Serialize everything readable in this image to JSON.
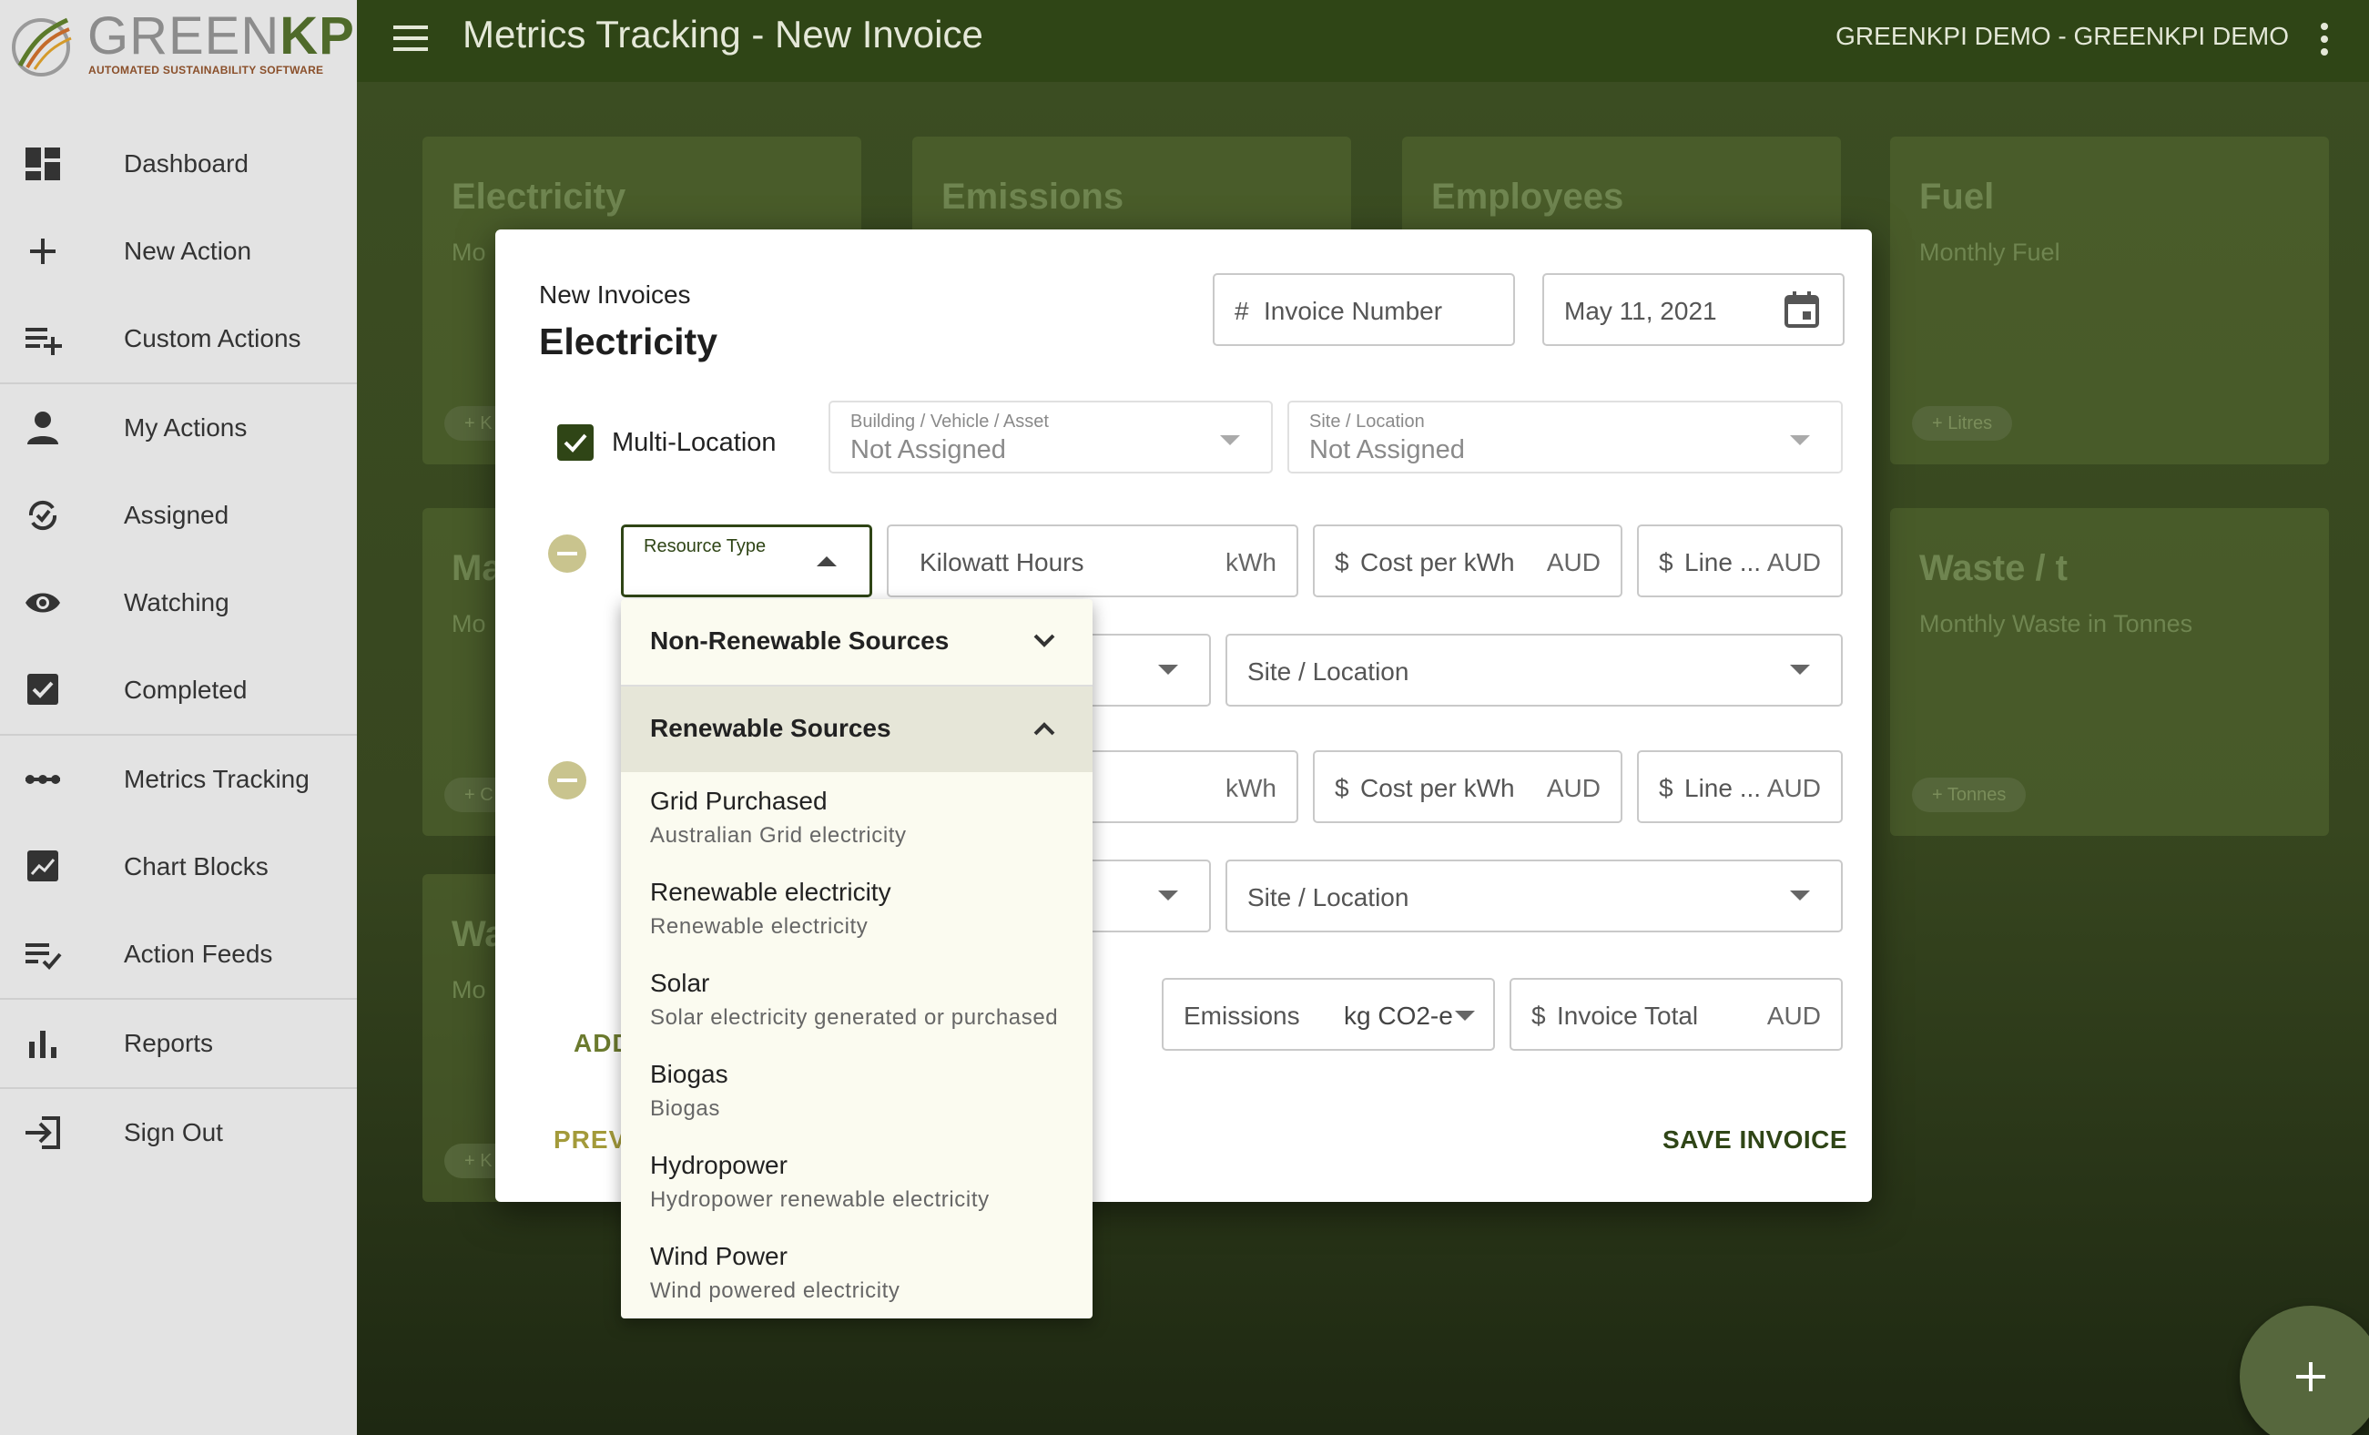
{
  "app": {
    "brand_main": "GREEN",
    "brand_accent": "KPI",
    "tagline": "AUTOMATED SUSTAINABILITY SOFTWARE",
    "page_title": "Metrics Tracking - New Invoice",
    "org": "GREENKPI DEMO - GREENKPI DEMO"
  },
  "sidebar": {
    "items": [
      {
        "label": "Dashboard",
        "icon": "dashboard-icon"
      },
      {
        "label": "New Action",
        "icon": "plus-icon"
      },
      {
        "label": "Custom Actions",
        "icon": "playlist-add-icon"
      },
      {
        "label": "My Actions",
        "icon": "person-icon"
      },
      {
        "label": "Assigned",
        "icon": "sync-check-icon"
      },
      {
        "label": "Watching",
        "icon": "eye-icon"
      },
      {
        "label": "Completed",
        "icon": "checkbox-icon"
      },
      {
        "label": "Metrics Tracking",
        "icon": "dots-line-icon"
      },
      {
        "label": "Chart Blocks",
        "icon": "chart-block-icon"
      },
      {
        "label": "Action Feeds",
        "icon": "list-check-icon"
      },
      {
        "label": "Reports",
        "icon": "bar-chart-icon"
      },
      {
        "label": "Sign Out",
        "icon": "sign-out-icon"
      }
    ]
  },
  "background_cards": [
    {
      "title": "Electricity",
      "subtitle": "Mo",
      "chip": "+ K"
    },
    {
      "title": "Emissions",
      "subtitle": "",
      "chip": ""
    },
    {
      "title": "Employees",
      "subtitle": "",
      "chip": ""
    },
    {
      "title": "Fuel",
      "subtitle": "Monthly Fuel",
      "chip": "+ Litres"
    },
    {
      "title": "Ma",
      "subtitle": "Mo",
      "chip": "+ C"
    },
    {
      "title": "Waste / t",
      "subtitle": "Monthly Waste in Tonnes",
      "chip": "+ Tonnes"
    },
    {
      "title": "Wa",
      "subtitle": "Mo",
      "chip": "+ K"
    }
  ],
  "dialog": {
    "subtitle": "New Invoices",
    "title": "Electricity",
    "invoice_number_placeholder": "Invoice Number",
    "invoice_number_prefix": "#",
    "date": "May 11, 2021",
    "multi_location_label": "Multi-Location",
    "multi_location_checked": true,
    "building_label": "Building / Vehicle / Asset",
    "building_value": "Not Assigned",
    "site_label": "Site / Location",
    "site_value": "Not Assigned",
    "lines": [
      {
        "resource_type_label": "Resource Type",
        "quantity_placeholder": "Kilowatt Hours",
        "quantity_unit": "kWh",
        "cost_prefix": "$",
        "cost_placeholder": "Cost per kWh",
        "cost_unit": "AUD",
        "line_prefix": "$",
        "line_placeholder": "Line ...",
        "line_unit": "AUD",
        "site_placeholder": "Site / Location"
      },
      {
        "quantity_unit": "kWh",
        "cost_prefix": "$",
        "cost_placeholder": "Cost per kWh",
        "cost_unit": "AUD",
        "line_prefix": "$",
        "line_placeholder": "Line ...",
        "line_unit": "AUD",
        "site_placeholder": "Site / Location"
      }
    ],
    "add_label": "ADD",
    "emissions_label": "Emissions",
    "emissions_unit": "kg CO2-e",
    "total_prefix": "$",
    "total_placeholder": "Invoice Total",
    "total_unit": "AUD",
    "prev_label": "PREVI",
    "save_label": "SAVE INVOICE"
  },
  "dropdown": {
    "groups": [
      {
        "label": "Non-Renewable Sources",
        "expanded": false
      },
      {
        "label": "Renewable Sources",
        "expanded": true
      }
    ],
    "options": [
      {
        "title": "Grid Purchased",
        "sub": "Australian Grid electricity"
      },
      {
        "title": "Renewable electricity",
        "sub": "Renewable electricity"
      },
      {
        "title": "Solar",
        "sub": "Solar electricity generated or purchased"
      },
      {
        "title": "Biogas",
        "sub": "Biogas"
      },
      {
        "title": "Hydropower",
        "sub": "Hydropower renewable electricity"
      },
      {
        "title": "Wind Power",
        "sub": "Wind powered electricity"
      }
    ]
  },
  "colors": {
    "brand_dark": "#2f4516",
    "accent_olive": "#6b7a2e",
    "remove_button": "#c9c48e"
  }
}
